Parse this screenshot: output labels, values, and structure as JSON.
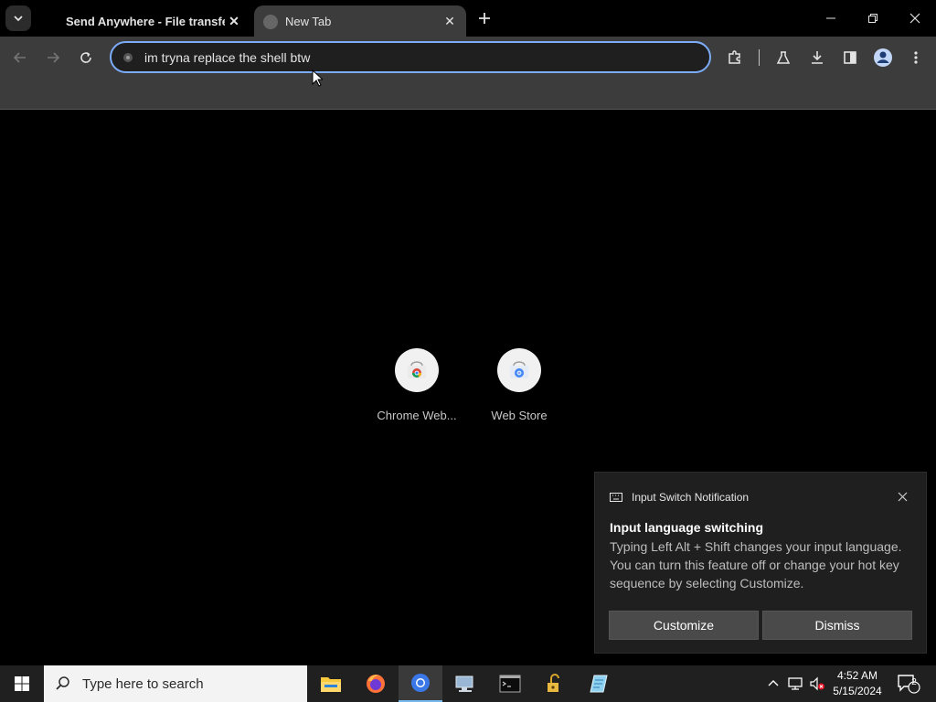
{
  "browser": {
    "tabs": [
      {
        "title": "Send Anywhere - File transfer",
        "active": false
      },
      {
        "title": "New Tab",
        "active": true
      }
    ],
    "omnibox": {
      "value": "im tryna replace the shell btw"
    }
  },
  "newtab": {
    "shortcuts": [
      {
        "label": "Chrome Web..."
      },
      {
        "label": "Web Store"
      }
    ]
  },
  "notification": {
    "app": "Input Switch Notification",
    "title": "Input language switching",
    "body": "Typing Left Alt + Shift changes your input language. You can turn this feature off or change your hot key sequence by selecting Customize.",
    "buttons": {
      "customize": "Customize",
      "dismiss": "Dismiss"
    }
  },
  "taskbar": {
    "search_placeholder": "Type here to search",
    "time": "4:52 AM",
    "date": "5/15/2024",
    "notification_count": "2"
  },
  "colors": {
    "accent": "#7cacf8",
    "taskbar_active": "#76b9ed"
  }
}
